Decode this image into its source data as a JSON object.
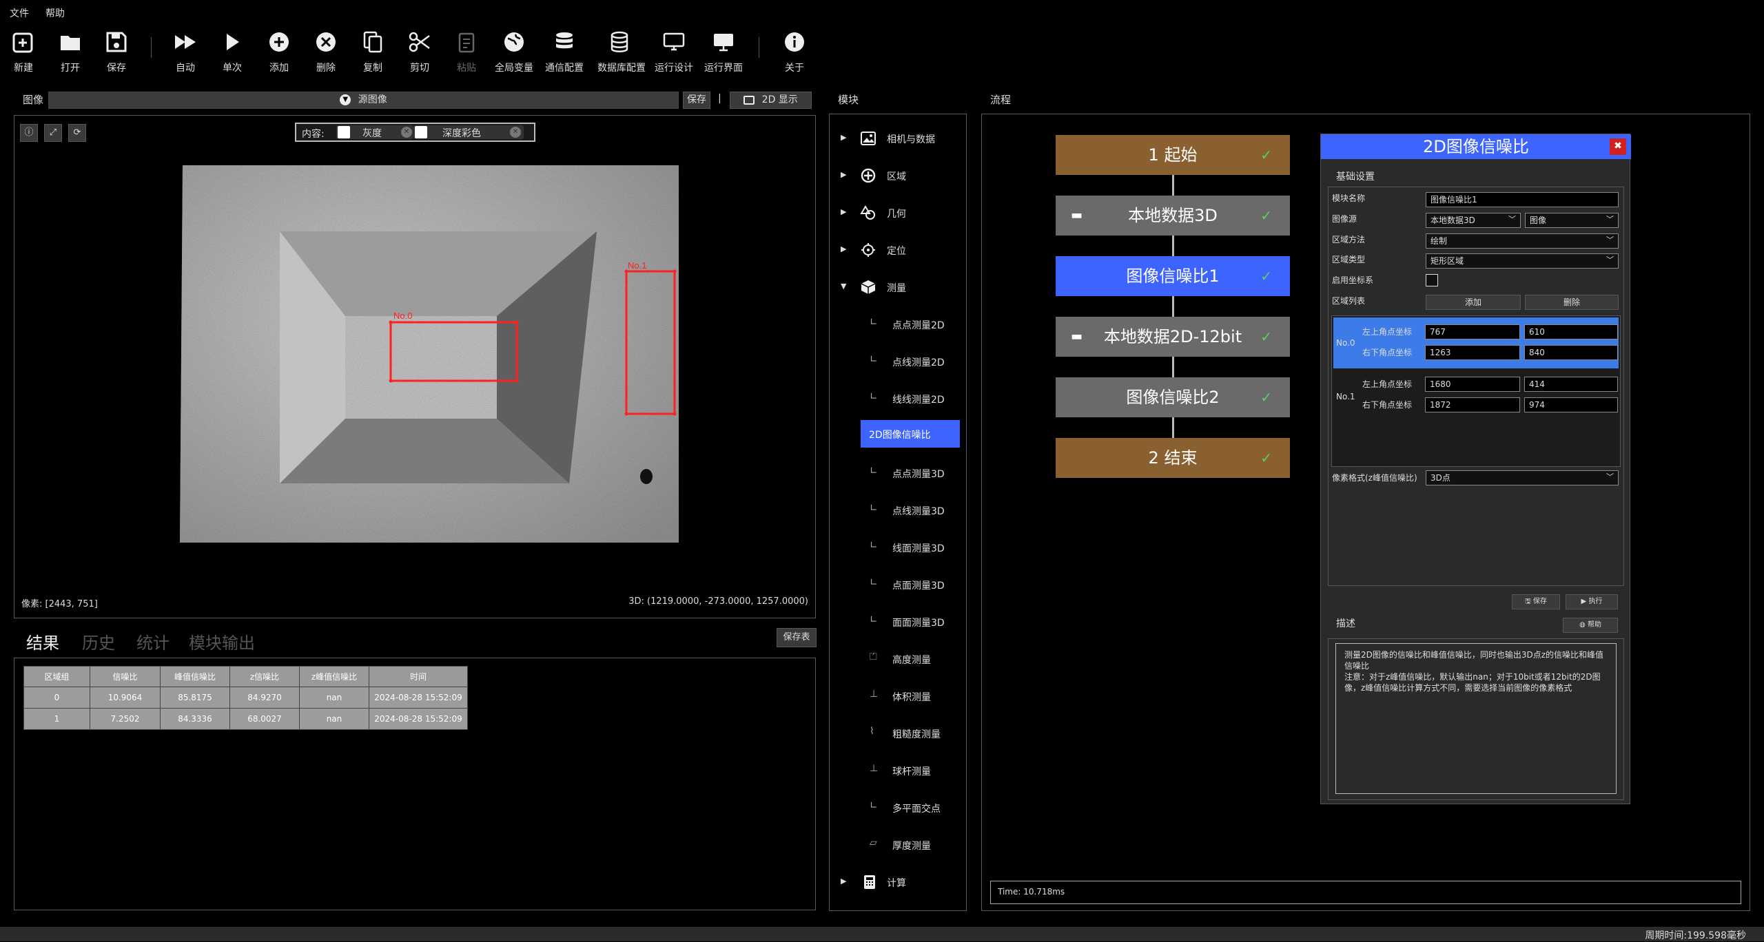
{
  "menu": {
    "file": "文件",
    "help": "帮助"
  },
  "toolbar": {
    "new": "新建",
    "open": "打开",
    "save": "保存",
    "auto": "自动",
    "single": "单次",
    "add": "添加",
    "delete": "删除",
    "copy": "复制",
    "cut": "剪切",
    "paste": "粘贴",
    "global_var": "全局变量",
    "comm": "通信配置",
    "db": "数据库配置",
    "run_design": "运行设计",
    "run_ui": "运行界面",
    "about": "关于"
  },
  "image_panel": {
    "title": "图像",
    "source": "源图像",
    "save": "保存",
    "separator": "|",
    "display": "2D 显示",
    "content_label": "内容:",
    "gray": "灰度",
    "depth_color": "深度彩色",
    "pixel_readout": "像素: [2443, 751]",
    "coord_readout": "3D: (1219.0000, -273.0000, 1257.0000)",
    "roi_labels": [
      "No.0",
      "No.1"
    ]
  },
  "results": {
    "tabs": [
      "结果",
      "历史",
      "统计",
      "模块输出"
    ],
    "save_table": "保存表",
    "columns": [
      "区域组",
      "信噪比",
      "峰值信噪比",
      "z信噪比",
      "z峰值信噪比",
      "时间"
    ],
    "rows": [
      [
        "0",
        "10.9064",
        "85.8175",
        "84.9270",
        "nan",
        "2024-08-28 15:52:09"
      ],
      [
        "1",
        "7.2502",
        "84.3336",
        "68.0027",
        "nan",
        "2024-08-28 15:52:09"
      ]
    ]
  },
  "modules": {
    "title": "模块",
    "groups": [
      "相机与数据",
      "区域",
      "几何",
      "定位",
      "测量"
    ],
    "measure_items": [
      "点点测量2D",
      "点线测量2D",
      "线线测量2D",
      "2D图像信噪比",
      "点点测量3D",
      "点线测量3D",
      "线面测量3D",
      "点面测量3D",
      "面面测量3D",
      "高度测量",
      "体积测量",
      "粗糙度测量",
      "球杆测量",
      "多平面交点",
      "厚度测量"
    ],
    "calc": "计算"
  },
  "flow": {
    "title": "流程",
    "nodes": [
      "1 起始",
      "本地数据3D",
      "图像信噪比1",
      "本地数据2D-12bit",
      "图像信噪比2",
      "2 结束"
    ],
    "time": "Time: 10.718ms"
  },
  "dialog": {
    "title": "2D图像信噪比",
    "section": "基础设置",
    "labels": {
      "module_name": "模块名称",
      "image_src": "图像源",
      "region_method": "区域方法",
      "region_type": "区域类型",
      "enable_coord": "启用坐标系",
      "region_list": "区域列表",
      "pixel_format": "像素格式(z峰值信噪比)"
    },
    "module_name_value": "图像信噪比1",
    "image_src_value": "本地数据3D",
    "image_src_sub": "图像",
    "region_method_value": "绘制",
    "region_type_value": "矩形区域",
    "add": "添加",
    "delete": "删除",
    "regions": [
      {
        "name": "No.0",
        "tl_label": "左上角点坐标",
        "br_label": "右下角点坐标",
        "tl": [
          "767",
          "610"
        ],
        "br": [
          "1263",
          "840"
        ]
      },
      {
        "name": "No.1",
        "tl_label": "左上角点坐标",
        "br_label": "右下角点坐标",
        "tl": [
          "1680",
          "414"
        ],
        "br": [
          "1872",
          "974"
        ]
      }
    ],
    "pixel_format_value": "3D点",
    "save": "保存",
    "run": "执行",
    "desc_title": "描述",
    "help": "帮助",
    "desc_text": "测量2D图像的信噪比和峰值信噪比，同时也输出3D点z的信噪比和峰值信噪比\n注意：对于z峰值信噪比，默认输出nan；对于10bit或者12bit的2D图像，z峰值信噪比计算方式不同，需要选择当前图像的像素格式"
  },
  "status": {
    "cycle": "周期时间:199.598毫秒"
  },
  "colors": {
    "accent": "#3d64ff",
    "node_brown": "#8a6030",
    "node_gray": "#6a6a6a",
    "roi_red": "#ff2020"
  }
}
